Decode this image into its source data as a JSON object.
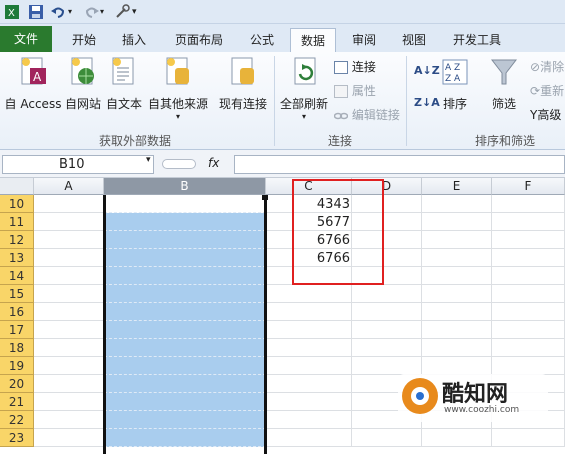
{
  "tabs": [
    "文件",
    "开始",
    "插入",
    "页面布局",
    "公式",
    "数据",
    "审阅",
    "视图",
    "开发工具"
  ],
  "ribbon": {
    "get_external": {
      "buttons": [
        "自 Access",
        "自网站",
        "自文本",
        "自其他来源",
        "现有连接"
      ],
      "group_label": "获取外部数据"
    },
    "connections": {
      "refresh_all": "全部刷新",
      "items": [
        "连接",
        "属性",
        "编辑链接"
      ],
      "group_label": "连接"
    },
    "sort_filter": {
      "sort": "排序",
      "filter": "筛选",
      "items": [
        "清除",
        "重新",
        "高级"
      ],
      "group_label": "排序和筛选"
    }
  },
  "formula_bar": {
    "name_box": "B10",
    "fx": "fx"
  },
  "columns": [
    "A",
    "B",
    "C",
    "D",
    "E",
    "F"
  ],
  "rows": [
    "10",
    "11",
    "12",
    "13",
    "14",
    "15",
    "16",
    "17",
    "18",
    "19",
    "20",
    "21",
    "22",
    "23"
  ],
  "column_c_values": [
    "4343",
    "5677",
    "6766",
    "6766"
  ],
  "watermark": {
    "name": "酷知网",
    "url": "www.coozhi.com"
  },
  "colors": {
    "file_tab": "#2a7a2e",
    "row_header": "#f9d568",
    "selection": "#a9cdee",
    "highlight_box": "#e02020"
  }
}
